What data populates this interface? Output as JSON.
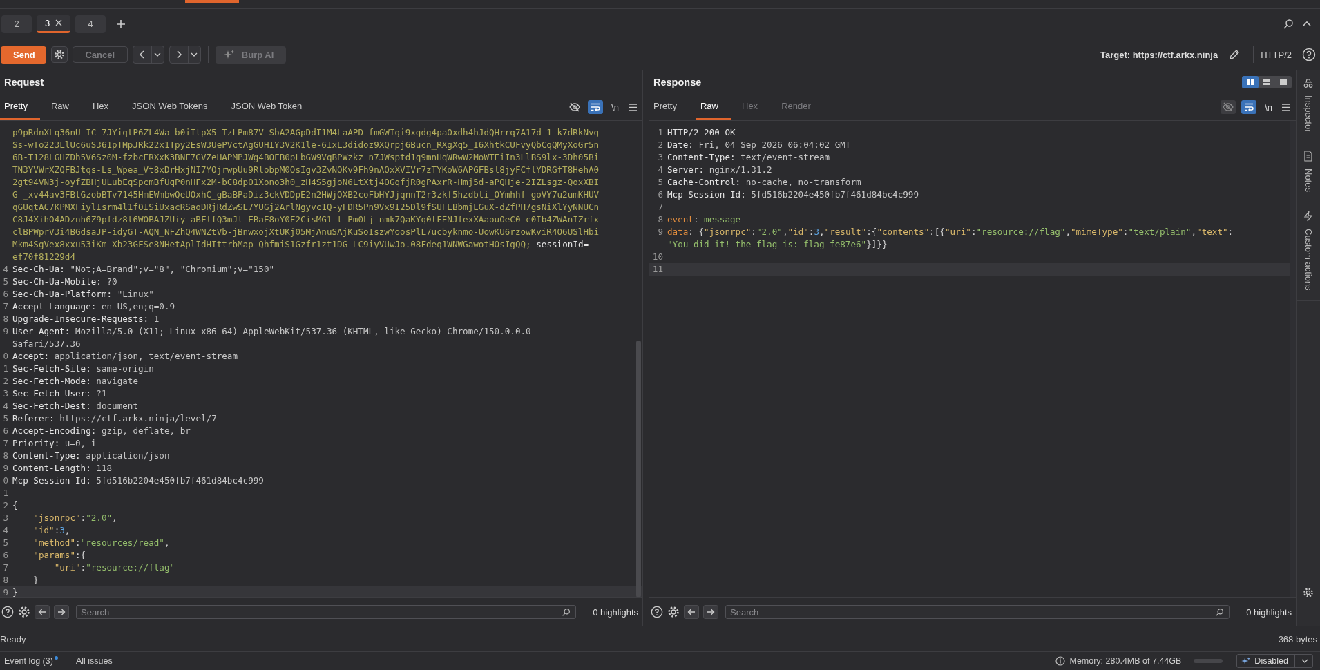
{
  "tabs": [
    {
      "label": "2",
      "selected": false,
      "closable": false
    },
    {
      "label": "3",
      "selected": true,
      "closable": true
    },
    {
      "label": "4",
      "selected": false,
      "closable": false
    }
  ],
  "toolbar": {
    "send": "Send",
    "cancel": "Cancel",
    "cancel_disabled": true,
    "burp_ai": "Burp AI",
    "burp_ai_disabled": true,
    "target": "Target: https://ctf.arkx.ninja",
    "protocol": "HTTP/2"
  },
  "request": {
    "title": "Request",
    "tabs": [
      {
        "label": "Pretty",
        "selected": true,
        "disabled": false
      },
      {
        "label": "Raw",
        "selected": false,
        "disabled": false
      },
      {
        "label": "Hex",
        "selected": false,
        "disabled": false
      },
      {
        "label": "JSON Web Tokens",
        "selected": false,
        "disabled": false
      },
      {
        "label": "JSON Web Token",
        "selected": false,
        "disabled": false
      }
    ],
    "hide_disabled": false,
    "wrap_on": true,
    "newline": "\\n",
    "lines": [
      {
        "segs": [
          {
            "kind": "token",
            "t": "p9pRdnXLq36nU-IC-7JYiqtP6ZL4Wa-b0iItpX5_TzLPm87V_SbA2AGpDdI1M4LaAPD_fmGWIgi9xgdg4paOxdh4hJdQHrrq7A17d_1_k7dRkNvg"
          }
        ]
      },
      {
        "segs": [
          {
            "kind": "token",
            "t": "Ss-wTo223LlUc6uS361pTMpJRk22x1Tpy2EsW3UePVctAgGUHIY3V2K1le-6IxL3didoz9XQrpj6Bucn_RXgXq5_I6XhtkCUFvyQbCqQMyXoGr5n"
          }
        ]
      },
      {
        "segs": [
          {
            "kind": "token",
            "t": "6B-T128LGHZDh5V6Sz0M-fzbcERXxK3BNF7GVZeHAPMPJWg4BOFB0pLbGW9VqBPWzkz_n7JWsptd1q9mnHqWRwW2MoWTEiIn3LlBS9lx-3Dh05Bi"
          }
        ]
      },
      {
        "segs": [
          {
            "kind": "token",
            "t": "TN3YVWrXZQFBJtqs-Ls_Wpea_Vt8xDrHxjNI7YOjrwpUu9RlobpM0OsIgv3ZvNOKv9Fh9nAOxXVIVr7zTYKoW6APGFBsl8jyFCflYDRGfT8HehA0"
          }
        ]
      },
      {
        "segs": [
          {
            "kind": "token",
            "t": "2gt94VN3j-oyfZBHjULubEqSpcmBfUqP0nHFx2M-bC8dpO1Xono3h0_zH4S5gjoN6LtXtj4OGqfjR0gPAxrR-Hmj5d-aPQHje-2IZLsgz-QoxXBI"
          }
        ]
      },
      {
        "segs": [
          {
            "kind": "token",
            "t": "G-_xv44av3FBtGzobBTv7145HmEWmbwQeUOxhC_gBaBPaDiz3ckVDDpE2n2HWjOXB2coFbHYJjqnnT2r3zkf5hzdbti_OYmhhf-goVY7u2umKHUV"
          }
        ]
      },
      {
        "segs": [
          {
            "kind": "token",
            "t": "qGUqtAC7KPMXFiylIsrm4l1fOISiUxacRSaoDRjRdZwSE7YUGj2ArlNgyvc1Q-yFDR5Pn9Vx9I25Dl9fSUFEBbmjEGuX-dZfPH7gsNiXlYyNNUCn"
          }
        ]
      },
      {
        "segs": [
          {
            "kind": "token",
            "t": "C8J4XihO4ADznh6Z9pfdz8l6WOBAJZUiy-aBFlfQ3mJl_EBaE8oY0F2CisMG1_t_Pm0Lj-nmk7QaKYq0tFENJfexXAaouOeC0-c0Ib4ZWAnIZrfx"
          }
        ]
      },
      {
        "segs": [
          {
            "kind": "token",
            "t": "clBPWprV3i4BGdsaJP-idyGT-AQN_NFZhQ4WNZtVb-jBnwxojXtUKj05MjAnuSAjKuSoIszwYoosPlL7ucbyknmo-UowKU6rzowKviR4O6USlHbi"
          }
        ]
      },
      {
        "segs": [
          {
            "kind": "token",
            "t": "Mkm4SgVex8xxu53iKm-Xb23GFSe8NHetAplIdHIttrbMap-QhfmiS1Gzfr1zt1DG-LC9iyVUwJo.08Fdeq1WNWGawotHOsIgQQ;"
          },
          {
            "kind": "name",
            "t": " sessionId="
          }
        ]
      },
      {
        "segs": [
          {
            "kind": "token",
            "t": "ef70f81229d4"
          }
        ]
      },
      {
        "num": "4",
        "segs": [
          {
            "kind": "name",
            "t": "Sec-Ch-Ua:"
          },
          {
            "kind": "value",
            "t": " \"Not;A=Brand\";v=\"8\", \"Chromium\";v=\"150\""
          }
        ]
      },
      {
        "num": "5",
        "segs": [
          {
            "kind": "name",
            "t": "Sec-Ch-Ua-Mobile:"
          },
          {
            "kind": "value",
            "t": " ?0"
          }
        ]
      },
      {
        "num": "6",
        "segs": [
          {
            "kind": "name",
            "t": "Sec-Ch-Ua-Platform:"
          },
          {
            "kind": "value",
            "t": " \"Linux\""
          }
        ]
      },
      {
        "num": "7",
        "segs": [
          {
            "kind": "name",
            "t": "Accept-Language:"
          },
          {
            "kind": "value",
            "t": " en-US,en;q=0.9"
          }
        ]
      },
      {
        "num": "8",
        "segs": [
          {
            "kind": "name",
            "t": "Upgrade-Insecure-Requests:"
          },
          {
            "kind": "value",
            "t": " 1"
          }
        ]
      },
      {
        "num": "9",
        "segs": [
          {
            "kind": "name",
            "t": "User-Agent:"
          },
          {
            "kind": "value",
            "t": " Mozilla/5.0 (X11; Linux x86_64) AppleWebKit/537.36 (KHTML, like Gecko) Chrome/150.0.0.0"
          }
        ]
      },
      {
        "segs": [
          {
            "kind": "value",
            "t": "Safari/537.36"
          }
        ]
      },
      {
        "num": "0",
        "segs": [
          {
            "kind": "name",
            "t": "Accept:"
          },
          {
            "kind": "value",
            "t": " application/json, text/event-stream"
          }
        ]
      },
      {
        "num": "1",
        "segs": [
          {
            "kind": "name",
            "t": "Sec-Fetch-Site:"
          },
          {
            "kind": "value",
            "t": " same-origin"
          }
        ]
      },
      {
        "num": "2",
        "segs": [
          {
            "kind": "name",
            "t": "Sec-Fetch-Mode:"
          },
          {
            "kind": "value",
            "t": " navigate"
          }
        ]
      },
      {
        "num": "3",
        "segs": [
          {
            "kind": "name",
            "t": "Sec-Fetch-User:"
          },
          {
            "kind": "value",
            "t": " ?1"
          }
        ]
      },
      {
        "num": "4",
        "segs": [
          {
            "kind": "name",
            "t": "Sec-Fetch-Dest:"
          },
          {
            "kind": "value",
            "t": " document"
          }
        ]
      },
      {
        "num": "5",
        "segs": [
          {
            "kind": "name",
            "t": "Referer:"
          },
          {
            "kind": "value",
            "t": " https://ctf.arkx.ninja/level/7"
          }
        ]
      },
      {
        "num": "6",
        "segs": [
          {
            "kind": "name",
            "t": "Accept-Encoding:"
          },
          {
            "kind": "value",
            "t": " gzip, deflate, br"
          }
        ]
      },
      {
        "num": "7",
        "segs": [
          {
            "kind": "name",
            "t": "Priority:"
          },
          {
            "kind": "value",
            "t": " u=0, i"
          }
        ]
      },
      {
        "num": "8",
        "segs": [
          {
            "kind": "name",
            "t": "Content-Type:"
          },
          {
            "kind": "value",
            "t": " application/json"
          }
        ]
      },
      {
        "num": "9",
        "segs": [
          {
            "kind": "name",
            "t": "Content-Length:"
          },
          {
            "kind": "value",
            "t": " 118"
          }
        ]
      },
      {
        "num": "0",
        "segs": [
          {
            "kind": "name",
            "t": "Mcp-Session-Id:"
          },
          {
            "kind": "value",
            "t": " 5fd516b2204e450fb7f461d84bc4c999"
          }
        ]
      },
      {
        "num": "1"
      },
      {
        "num": "2",
        "segs": [
          {
            "kind": "punct",
            "t": "{"
          }
        ]
      },
      {
        "num": "3",
        "segs": [
          {
            "kind": "jkey",
            "t": "    \"jsonrpc\""
          },
          {
            "kind": "punct",
            "t": ":"
          },
          {
            "kind": "jstr",
            "t": "\"2.0\""
          },
          {
            "kind": "punct",
            "t": ","
          }
        ]
      },
      {
        "num": "4",
        "segs": [
          {
            "kind": "jkey",
            "t": "    \"id\""
          },
          {
            "kind": "punct",
            "t": ":"
          },
          {
            "kind": "jnum",
            "t": "3"
          },
          {
            "kind": "punct",
            "t": ","
          }
        ]
      },
      {
        "num": "5",
        "segs": [
          {
            "kind": "jkey",
            "t": "    \"method\""
          },
          {
            "kind": "punct",
            "t": ":"
          },
          {
            "kind": "jstr",
            "t": "\"resources/read\""
          },
          {
            "kind": "punct",
            "t": ","
          }
        ]
      },
      {
        "num": "6",
        "segs": [
          {
            "kind": "jkey",
            "t": "    \"params\""
          },
          {
            "kind": "punct",
            "t": ":{"
          }
        ]
      },
      {
        "num": "7",
        "segs": [
          {
            "kind": "jkey",
            "t": "        \"uri\""
          },
          {
            "kind": "punct",
            "t": ":"
          },
          {
            "kind": "jstr",
            "t": "\"resource://flag\""
          }
        ]
      },
      {
        "num": "8",
        "segs": [
          {
            "kind": "punct",
            "t": "    }"
          }
        ]
      },
      {
        "num": "9",
        "current": true,
        "segs": [
          {
            "kind": "punct",
            "t": "}"
          }
        ]
      }
    ],
    "search": {
      "placeholder": "Search"
    },
    "highlights": "0 highlights"
  },
  "response": {
    "title": "Response",
    "tabs": [
      {
        "label": "Pretty",
        "selected": false,
        "disabled": false
      },
      {
        "label": "Raw",
        "selected": true,
        "disabled": false
      },
      {
        "label": "Hex",
        "selected": false,
        "disabled": true
      },
      {
        "label": "Render",
        "selected": false,
        "disabled": true
      }
    ],
    "layout": [
      {
        "selected": true
      },
      {
        "selected": false
      },
      {
        "selected": false
      }
    ],
    "hide_disabled": true,
    "wrap_on": true,
    "newline": "\\n",
    "lines": [
      {
        "num": "1",
        "segs": [
          {
            "kind": "name",
            "t": "HTTP/2 200 OK"
          }
        ]
      },
      {
        "num": "2",
        "segs": [
          {
            "kind": "name",
            "t": "Date:"
          },
          {
            "kind": "value",
            "t": " Fri, 04 Sep 2026 06:04:02 GMT"
          }
        ]
      },
      {
        "num": "3",
        "segs": [
          {
            "kind": "name",
            "t": "Content-Type:"
          },
          {
            "kind": "value",
            "t": " text/event-stream"
          }
        ]
      },
      {
        "num": "4",
        "segs": [
          {
            "kind": "name",
            "t": "Server:"
          },
          {
            "kind": "value",
            "t": " nginx/1.31.2"
          }
        ]
      },
      {
        "num": "5",
        "segs": [
          {
            "kind": "name",
            "t": "Cache-Control:"
          },
          {
            "kind": "value",
            "t": " no-cache, no-transform"
          }
        ]
      },
      {
        "num": "6",
        "segs": [
          {
            "kind": "name",
            "t": "Mcp-Session-Id:"
          },
          {
            "kind": "value",
            "t": " 5fd516b2204e450fb7f461d84bc4c999"
          }
        ]
      },
      {
        "num": "7"
      },
      {
        "num": "8",
        "segs": [
          {
            "kind": "ekey",
            "t": "event"
          },
          {
            "kind": "punct",
            "t": ": "
          },
          {
            "kind": "jstr",
            "t": "message"
          }
        ]
      },
      {
        "num": "9",
        "segs": [
          {
            "kind": "ekey",
            "t": "data"
          },
          {
            "kind": "punct",
            "t": ": {"
          },
          {
            "kind": "jkey",
            "t": "\"jsonrpc\""
          },
          {
            "kind": "punct",
            "t": ":"
          },
          {
            "kind": "jstr",
            "t": "\"2.0\""
          },
          {
            "kind": "punct",
            "t": ","
          },
          {
            "kind": "jkey",
            "t": "\"id\""
          },
          {
            "kind": "punct",
            "t": ":"
          },
          {
            "kind": "jnum",
            "t": "3"
          },
          {
            "kind": "punct",
            "t": ","
          },
          {
            "kind": "jkey",
            "t": "\"result\""
          },
          {
            "kind": "punct",
            "t": ":{"
          },
          {
            "kind": "jkey",
            "t": "\"contents\""
          },
          {
            "kind": "punct",
            "t": ":[{"
          },
          {
            "kind": "jkey",
            "t": "\"uri\""
          },
          {
            "kind": "punct",
            "t": ":"
          },
          {
            "kind": "jstr",
            "t": "\"resource://flag\""
          },
          {
            "kind": "punct",
            "t": ","
          },
          {
            "kind": "jkey",
            "t": "\"mimeType\""
          },
          {
            "kind": "punct",
            "t": ":"
          },
          {
            "kind": "jstr",
            "t": "\"text/plain\""
          },
          {
            "kind": "punct",
            "t": ","
          },
          {
            "kind": "jkey",
            "t": "\"text\""
          },
          {
            "kind": "punct",
            "t": ":"
          }
        ]
      },
      {
        "segs": [
          {
            "kind": "jstr",
            "t": "\"You did it! the flag is: flag-fe87e6\""
          },
          {
            "kind": "punct",
            "t": "}]}}"
          }
        ]
      },
      {
        "num": "10"
      },
      {
        "num": "11",
        "current": true
      }
    ],
    "search": {
      "placeholder": "Search"
    },
    "highlights": "0 highlights"
  },
  "sidebar": [
    {
      "label": "Inspector",
      "kind": "inspector"
    },
    {
      "label": "Notes",
      "kind": "notes"
    },
    {
      "label": "Custom actions",
      "kind": "actions"
    }
  ],
  "status": {
    "left": "Ready",
    "right": "368 bytes"
  },
  "footer": {
    "event_log": "Event log (3)",
    "event_log_unread": true,
    "all_issues": "All issues",
    "memory": "Memory: 280.4MB of 7.44GB",
    "ai_mode": "Disabled"
  }
}
